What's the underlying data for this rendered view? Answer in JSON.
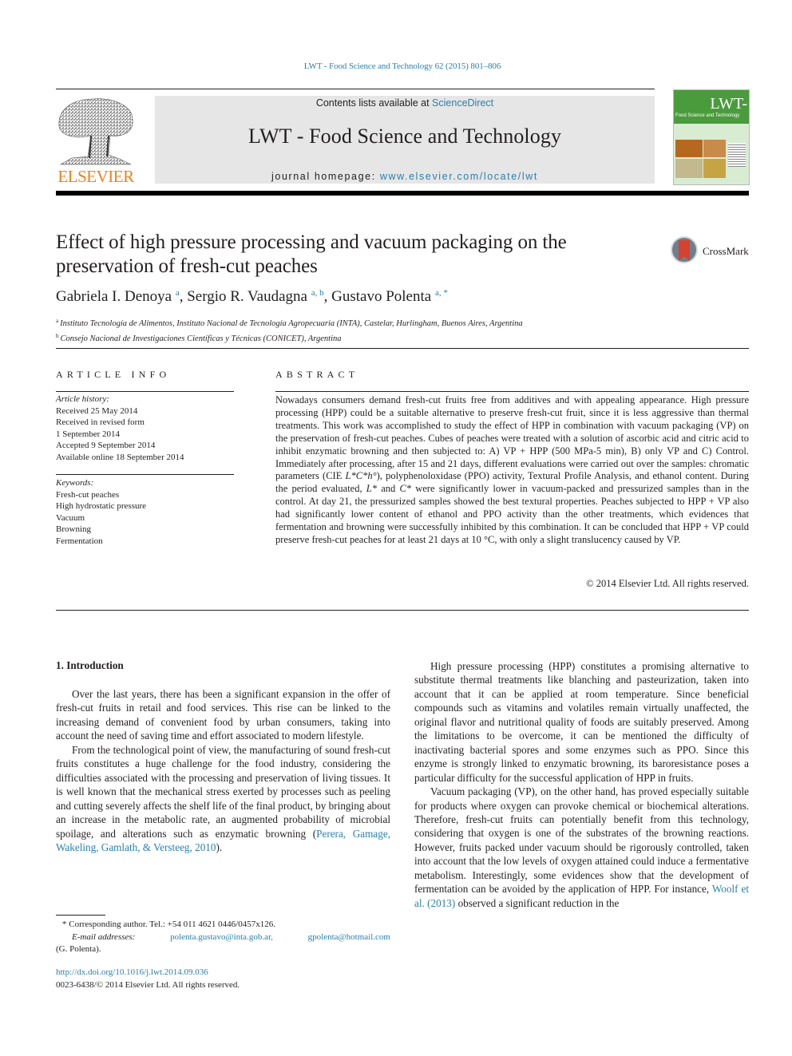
{
  "header": {
    "journal_reference": "LWT - Food Science and Technology 62 (2015) 801–806",
    "contents_prefix": "Contents lists available at ",
    "contents_link": "ScienceDirect",
    "journal_title": "LWT - Food Science and Technology",
    "homepage_prefix": "journal homepage: ",
    "homepage_link": "www.elsevier.com/locate/lwt",
    "publisher_logo_text": "ELSEVIER",
    "cover": {
      "title": "LWT-",
      "subtitle": "Food Science and Technology"
    },
    "colors": {
      "link": "#2a7fae",
      "elsevier_orange": "#f07f1b",
      "masthead_bg": "#e6e6e6",
      "cover_green": "#4a9b3c"
    }
  },
  "article": {
    "title_line1": "Effect of high pressure processing and vacuum packaging on the",
    "title_line2": "preservation of fresh-cut peaches",
    "crossmark_label": "CrossMark",
    "authors": [
      {
        "name": "Gabriela I. Denoya",
        "marks": "a"
      },
      {
        "name": "Sergio R. Vaudagna",
        "marks": "a, b"
      },
      {
        "name": "Gustavo Polenta",
        "marks": "a, *"
      }
    ],
    "affiliations": [
      {
        "mark": "a",
        "text": "Instituto Tecnología de Alimentos, Instituto Nacional de Tecnología Agropecuaria (INTA), Castelar, Hurlingham, Buenos Aires, Argentina"
      },
      {
        "mark": "b",
        "text": "Consejo Nacional de Investigaciones Científicas y Técnicas (CONICET), Argentina"
      }
    ]
  },
  "article_info": {
    "heading": "ARTICLE INFO",
    "history_label": "Article history:",
    "history": [
      "Received 25 May 2014",
      "Received in revised form",
      "1 September 2014",
      "Accepted 9 September 2014",
      "Available online 18 September 2014"
    ],
    "keywords_label": "Keywords:",
    "keywords": [
      "Fresh-cut peaches",
      "High hydrostatic pressure",
      "Vacuum",
      "Browning",
      "Fermentation"
    ]
  },
  "abstract": {
    "heading": "ABSTRACT",
    "part1": "Nowadays consumers demand fresh-cut fruits free from additives and with appealing appearance. High pressure processing (HPP) could be a suitable alternative to preserve fresh-cut fruit, since it is less aggressive than thermal treatments. This work was accomplished to study the effect of HPP in combi­nation with vacuum packaging (VP) on the preservation of fresh-cut peaches. Cubes of peaches were treated with a solution of ascorbic acid and citric acid to inhibit enzymatic browning and then subjected to: A) VP + HPP (500 MPa-5 min), B) only VP and C) Control. Immediately after processing, after 15 and 21 days, different evaluations were carried out over the samples: chromatic parameters (CIE ",
    "cie_param": "L*C*h°",
    "part2": "), polyphenoloxidase (PPO) activity, Textural Profile Analysis, and ethanol content. During the period evaluated, ",
    "l_star": "L*",
    "and_word": " and ",
    "c_star": "C*",
    "part3": " were significantly lower in vacuum-packed and pressurized samples than in the control. At day 21, the pressurized samples showed the best textural properties. Peaches subjected to HPP + VP also had significantly lower content of ethanol and PPO activity than the other treatments, which evidences that fermentation and browning were successfully inhibited by this combination. It can be concluded that HPP + VP could preserve fresh-cut peaches for at least 21 days at 10 °C, with only a slight translucency caused by VP.",
    "copyright": "© 2014 Elsevier Ltd. All rights reserved."
  },
  "body": {
    "section_heading": "1.  Introduction",
    "left_paragraphs": [
      "Over the last years, there has been a significant expansion in the offer of fresh-cut fruits in retail and food services. This rise can be linked to the increasing demand of convenient food by urban consumers, taking into account the need of saving time and effort associated to modern lifestyle.",
      "From the technological point of view, the manufacturing of sound fresh-cut fruits constitutes a huge challenge for the food industry, considering the difficulties associated with the processing and preservation of living tissues. It is well known that the me­chanical stress exerted by processes such as peeling and cutting severely affects the shelf life of the final product, by bringing about an increase in the metabolic rate, an augmented probability of microbial spoilage, and alterations such as enzymatic browning ("
    ],
    "citation_perera": "Perera, Gamage, Wakeling, Gamlath, & Versteeg, 2010",
    "citation_perera_suffix": ").",
    "right_paragraph1": "High pressure processing (HPP) constitutes a promising alter­native to substitute thermal treatments like blanching and pasteurization, taken into account that it can be applied at room temperature. Since beneficial compounds such as vitamins and volatiles remain virtually unaffected, the original flavor and nutri­tional quality of foods are suitably preserved. Among the limita­tions to be overcome, it can be mentioned the difficulty of inactivating bacterial spores and some enzymes such as PPO. Since this enzyme is strongly linked to enzymatic browning, its barore­sistance poses a particular difficulty for the successful application of HPP in fruits.",
    "right_paragraph2": "Vacuum packaging (VP), on the other hand, has proved espe­cially suitable for products where oxygen can provoke chemical or biochemical alterations. Therefore, fresh-cut fruits can potentially benefit from this technology, considering that oxygen is one of the substrates of the browning reactions. However, fruits packed under vacuum should be rigorously controlled, taken into account that the low levels of oxygen attained could induce a fermentative meta­bolism. Interestingly, some evidences show that the development of fermentation can be avoided by the application of HPP. For instance, ",
    "citation_woolf": "Woolf et al. (2013)",
    "right_paragraph2_tail": " observed a significant reduction in the"
  },
  "footnotes": {
    "corresponding": "* Corresponding author. Tel.: +54 011 4621 0446/0457x126.",
    "email_label": "E-mail addresses:",
    "email1": "polenta.gustavo@inta.gob.ar,",
    "email2": "gpolenta@hotmail.com",
    "email_owner": "(G. Polenta).",
    "doi_link": "http://dx.doi.org/10.1016/j.lwt.2014.09.036",
    "issn_copyright": "0023-6438/© 2014 Elsevier Ltd. All rights reserved."
  }
}
